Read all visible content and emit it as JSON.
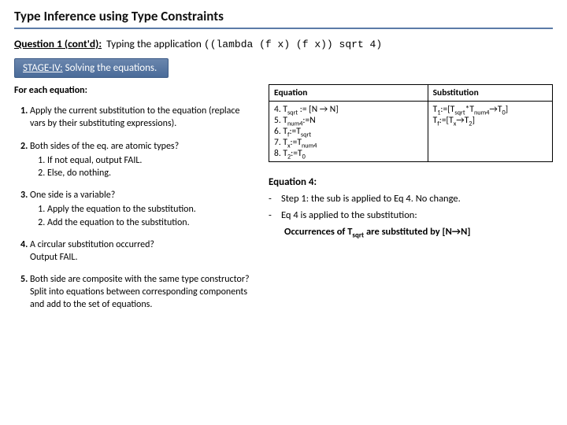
{
  "title": "Type Inference using Type Constraints",
  "question": {
    "label": "Question 1 (cont'd):",
    "intro": "Typing the application",
    "code": "((lambda (f x) (f x)) sqrt 4)"
  },
  "stage": {
    "prefix": "STAGE-IV:",
    "text": "Solving the equations."
  },
  "forEach": "For each equation:",
  "steps": {
    "s1": "Apply the current substitution to the equation (replace vars by their substituting expressions).",
    "s2": "Both sides of the eq. are atomic types?",
    "s2a": "If not equal, output FAIL.",
    "s2b": "Else, do nothing.",
    "s3": "One side is a variable?",
    "s3a": "Apply the equation to the substitution.",
    "s3b": "Add the equation to the substitution.",
    "s4": "A circular substitution occurred?",
    "s4b": "Output FAIL.",
    "s5": "Both side are composite with the same type constructor?",
    "s5b": "Split into equations between corresponding components and add to the set of equations."
  },
  "table": {
    "h1": "Equation",
    "h2": "Substitution",
    "eqs": {
      "e4": "4. T<sub>sqrt</sub> := [N → N]",
      "e5": "5. T<sub>num4</sub>:=N",
      "e6": "6. T<sub>f</sub>:=T<sub>sqrt</sub>",
      "e7": "7. T<sub>x</sub>:=T<sub>num4</sub>",
      "e8": "8. T<sub>2</sub>:=T<sub>0</sub>"
    },
    "subs": {
      "l1": "T<sub>1</sub>:=[T<sub>sqrt</sub>*T<sub>num4</sub>→T<sub>0</sub>]",
      "l2": "T<sub>f</sub>:=[T<sub>x</sub>→T<sub>2</sub>]"
    }
  },
  "explain": {
    "heading": "Equation 4:",
    "b1": "Step 1: the sub is applied to Eq 4. No change.",
    "b2": "Eq 4 is applied to the substitution:",
    "occ": "Occurrences of T<sub>sqrt</sub> are substituted by [N→N]"
  }
}
